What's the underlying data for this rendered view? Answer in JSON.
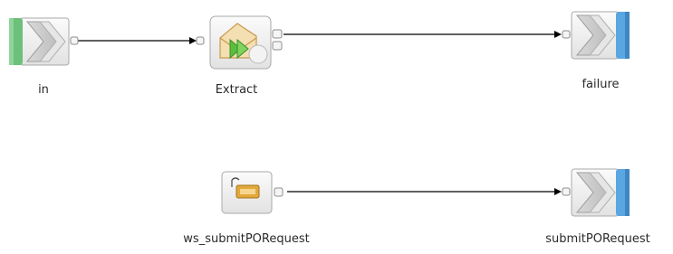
{
  "nodes": {
    "in": {
      "label": "in"
    },
    "extract": {
      "label": "Extract"
    },
    "failure": {
      "label": "failure"
    },
    "ws_submit": {
      "label": "ws_submitPORequest"
    },
    "submit": {
      "label": "submitPORequest"
    }
  },
  "colors": {
    "input_bar": "#6cc07a",
    "output_bar": "#5aa6e0",
    "node_border": "#a9a9a9",
    "node_fill_top": "#fbfbfb",
    "node_fill_bottom": "#e2e2e2",
    "chevron": "#c9c9c9",
    "connector": "#000000",
    "extract_icon_green": "#5bbd3c",
    "extract_icon_envelope": "#d6b874",
    "ws_icon_gold": "#e1a93b"
  },
  "icons": {
    "in": "input-node-icon",
    "extract": "extract-mapping-icon",
    "failure": "output-node-icon",
    "ws_submit": "web-service-tag-icon",
    "submit": "output-node-icon"
  }
}
